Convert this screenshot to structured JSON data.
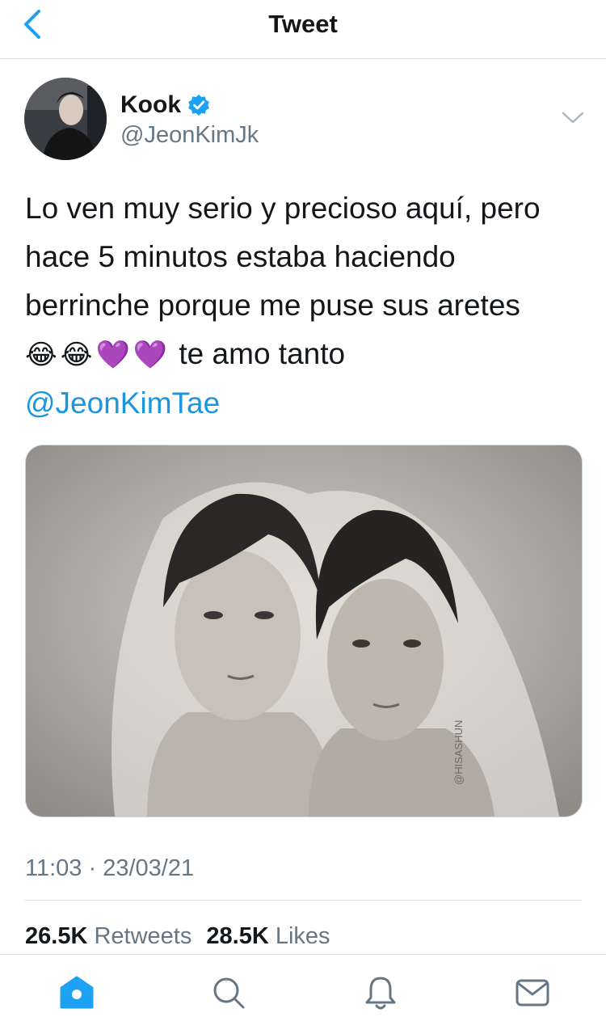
{
  "header": {
    "title": "Tweet",
    "back_icon": "chevron-left-icon"
  },
  "tweet": {
    "author": {
      "name": "Kook",
      "handle": "@JeonKimJk",
      "verified": true
    },
    "text_lines": [
      "Lo ven muy serio y precioso aquí, pero",
      "hace 5 minutos estaba haciendo",
      "berrinche porque me puse sus aretes"
    ],
    "emojis": "😂😂💜💜",
    "text_tail": "te amo tanto",
    "mention": "@JeonKimTae",
    "media": {
      "watermark": "@HISASHUN"
    },
    "timestamp": "11:03 · 23/03/21",
    "retweets_count": "26.5K",
    "retweets_label": "Retweets",
    "likes_count": "28.5K",
    "likes_label": "Likes"
  },
  "tabbar": {
    "items": [
      {
        "name": "home-icon",
        "active": true
      },
      {
        "name": "search-icon",
        "active": false
      },
      {
        "name": "notifications-icon",
        "active": false
      },
      {
        "name": "messages-icon",
        "active": false
      }
    ]
  },
  "colors": {
    "accent": "#1da1f2",
    "link": "#1b95e0",
    "secondary_text": "#657786",
    "divider": "#d8dde2"
  }
}
